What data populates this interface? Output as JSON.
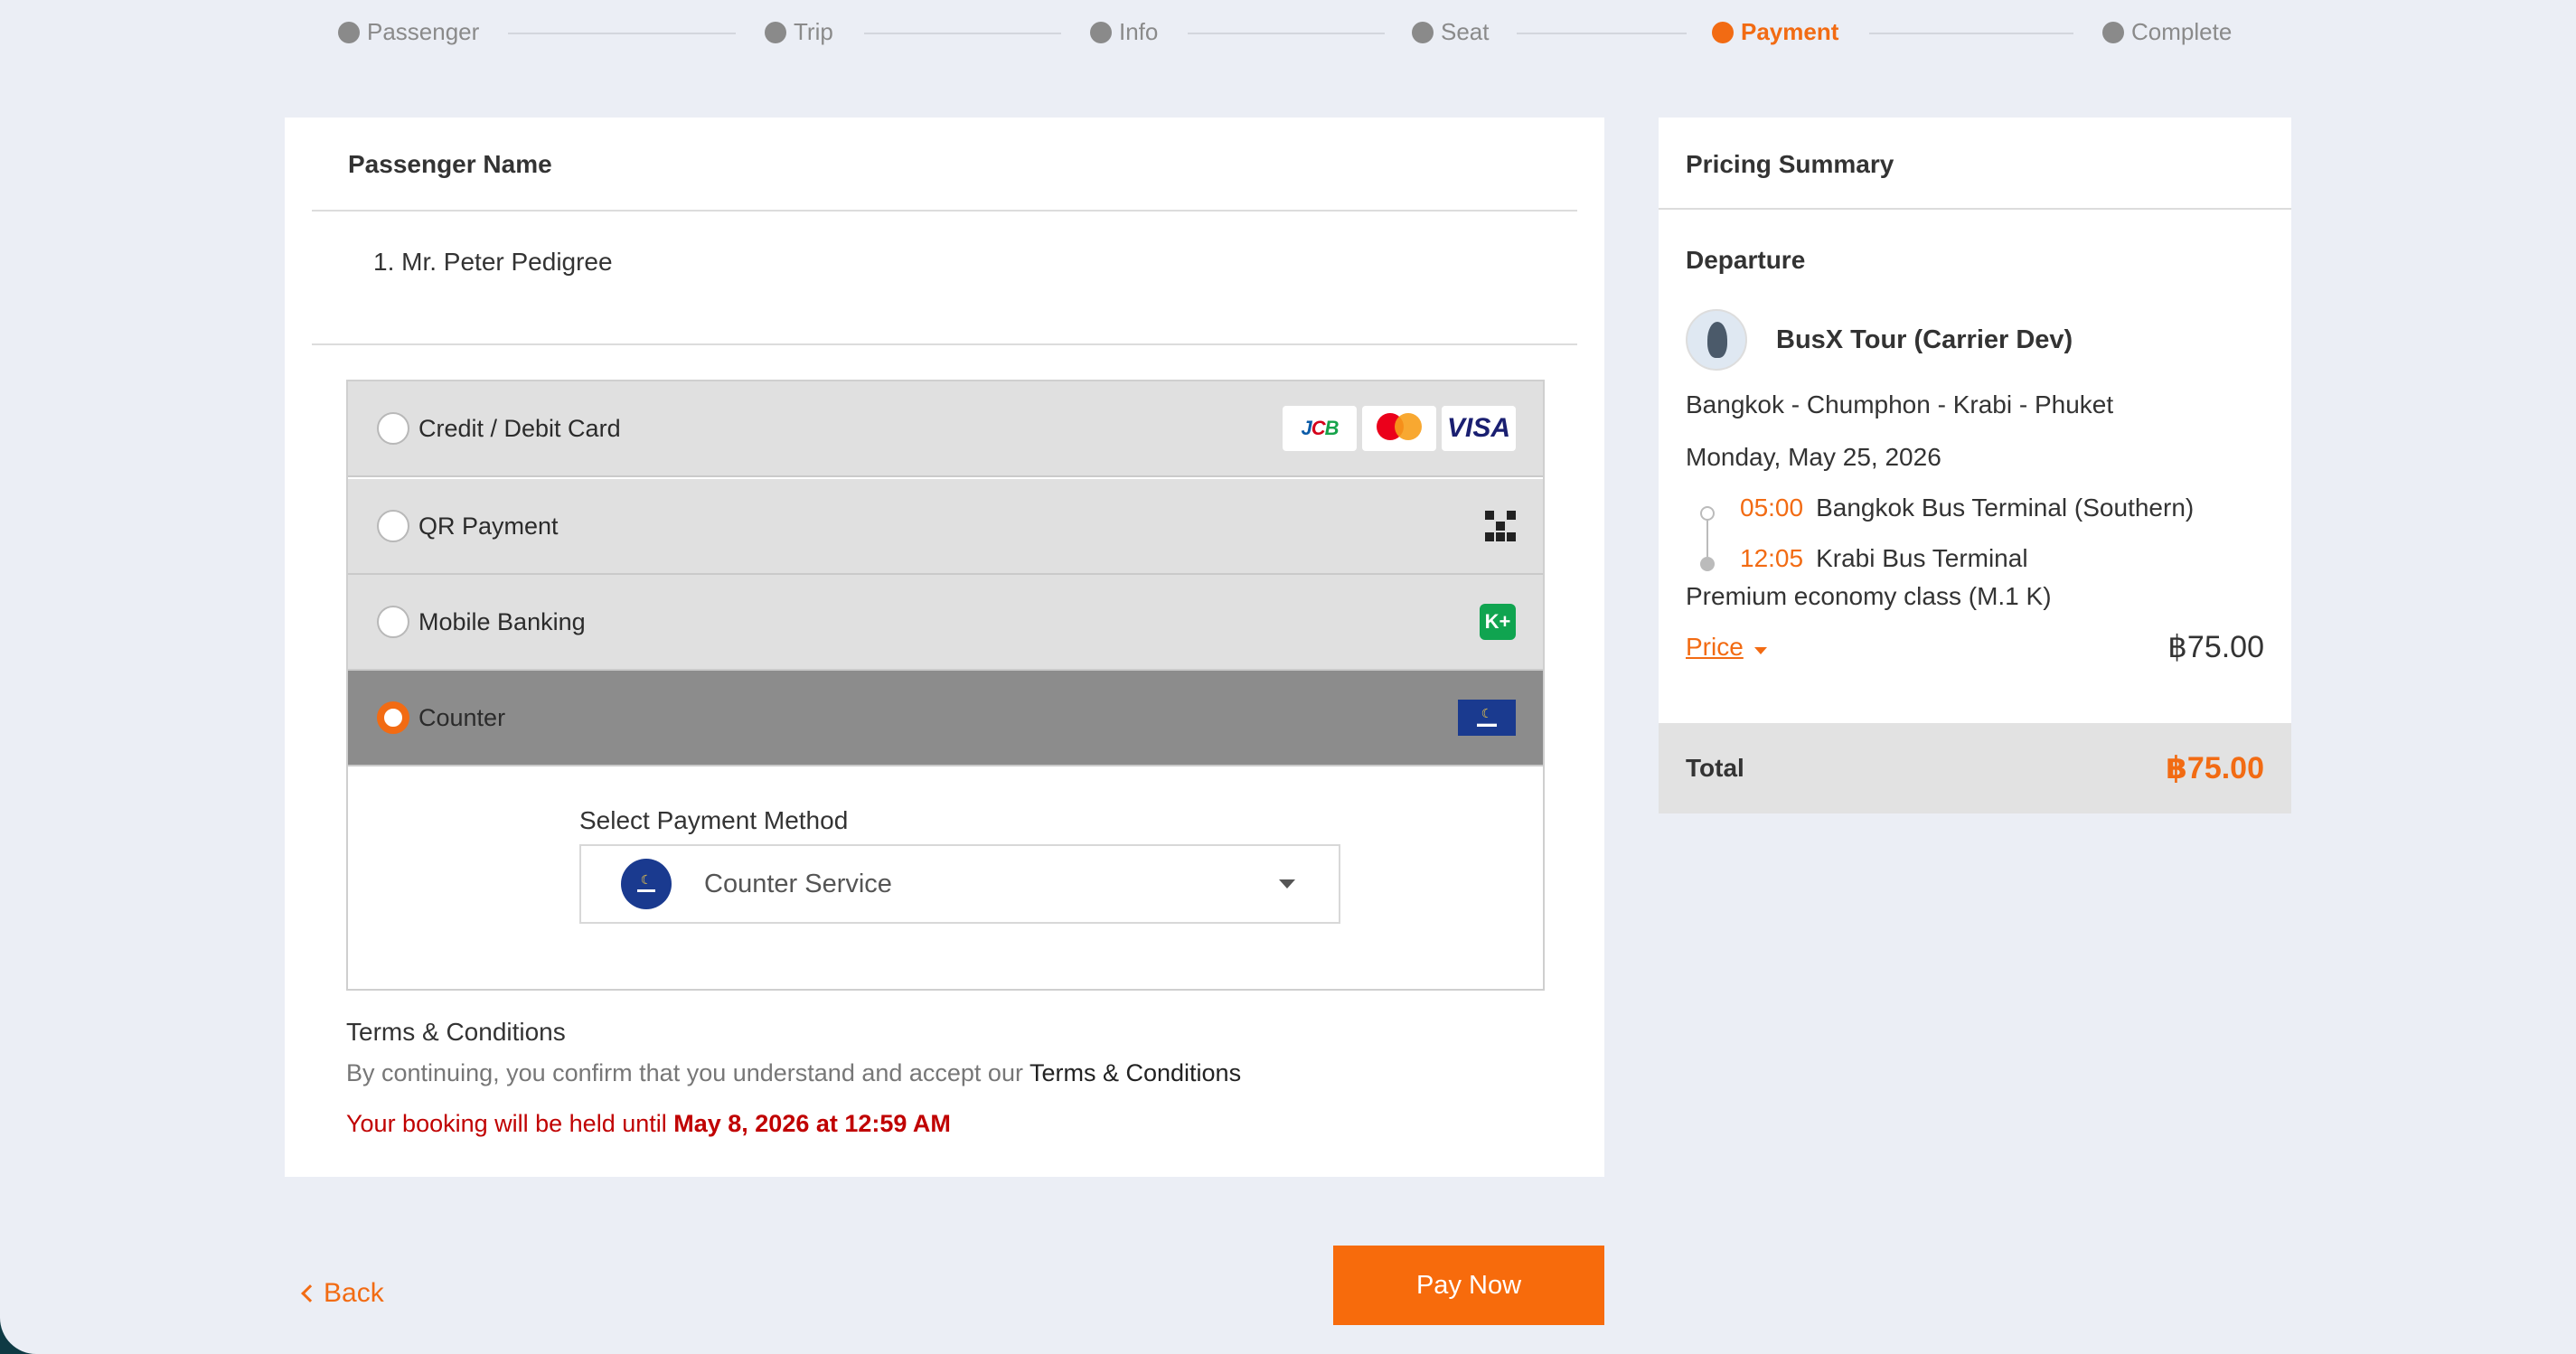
{
  "steps": [
    {
      "label": "Passenger"
    },
    {
      "label": "Trip"
    },
    {
      "label": "Info"
    },
    {
      "label": "Seat"
    },
    {
      "label": "Payment"
    },
    {
      "label": "Complete"
    }
  ],
  "passenger": {
    "title": "Passenger Name",
    "items": [
      "1. Mr. Peter Pedigree"
    ]
  },
  "payment": {
    "options": [
      {
        "label": "Credit / Debit Card",
        "icons": [
          "jcb-icon",
          "mastercard-icon",
          "visa-icon"
        ],
        "selected": false
      },
      {
        "label": "QR Payment",
        "icons": [
          "qr-code-icon"
        ],
        "selected": false
      },
      {
        "label": "Mobile Banking",
        "icons": [
          "kplus-icon"
        ],
        "selected": false
      },
      {
        "label": "Counter",
        "icons": [
          "counter-service-icon"
        ],
        "selected": true
      }
    ],
    "card_logos": {
      "jcb_j": "J",
      "jcb_c": "C",
      "jcb_b": "B",
      "visa": "VISA",
      "kplus": "K+"
    },
    "select_label": "Select Payment Method",
    "select_value": "Counter Service"
  },
  "terms": {
    "title": "Terms & Conditions",
    "text": "By continuing, you confirm that you understand and accept our ",
    "link": "Terms & Conditions",
    "hold_prefix": "Your booking will be held until ",
    "hold_date": "May 8, 2026 at 12:59 AM"
  },
  "summary": {
    "title": "Pricing Summary",
    "departure_label": "Departure",
    "carrier": "BusX Tour (Carrier Dev)",
    "route": "Bangkok - Chumphon - Krabi - Phuket",
    "date": "Monday, May 25, 2026",
    "stops": [
      {
        "time": "05:00",
        "name": "Bangkok Bus Terminal (Southern)"
      },
      {
        "time": "12:05",
        "name": "Krabi Bus Terminal"
      }
    ],
    "class": "Premium economy class (M.1 K)",
    "price_label": "Price",
    "price_value": "฿75.00",
    "total_label": "Total",
    "total_value": "฿75.00"
  },
  "actions": {
    "back": "Back",
    "pay_now": "Pay Now"
  },
  "colors": {
    "accent": "#f26b13",
    "hold_text": "#c00000",
    "page_bg": "#ebeef5"
  }
}
